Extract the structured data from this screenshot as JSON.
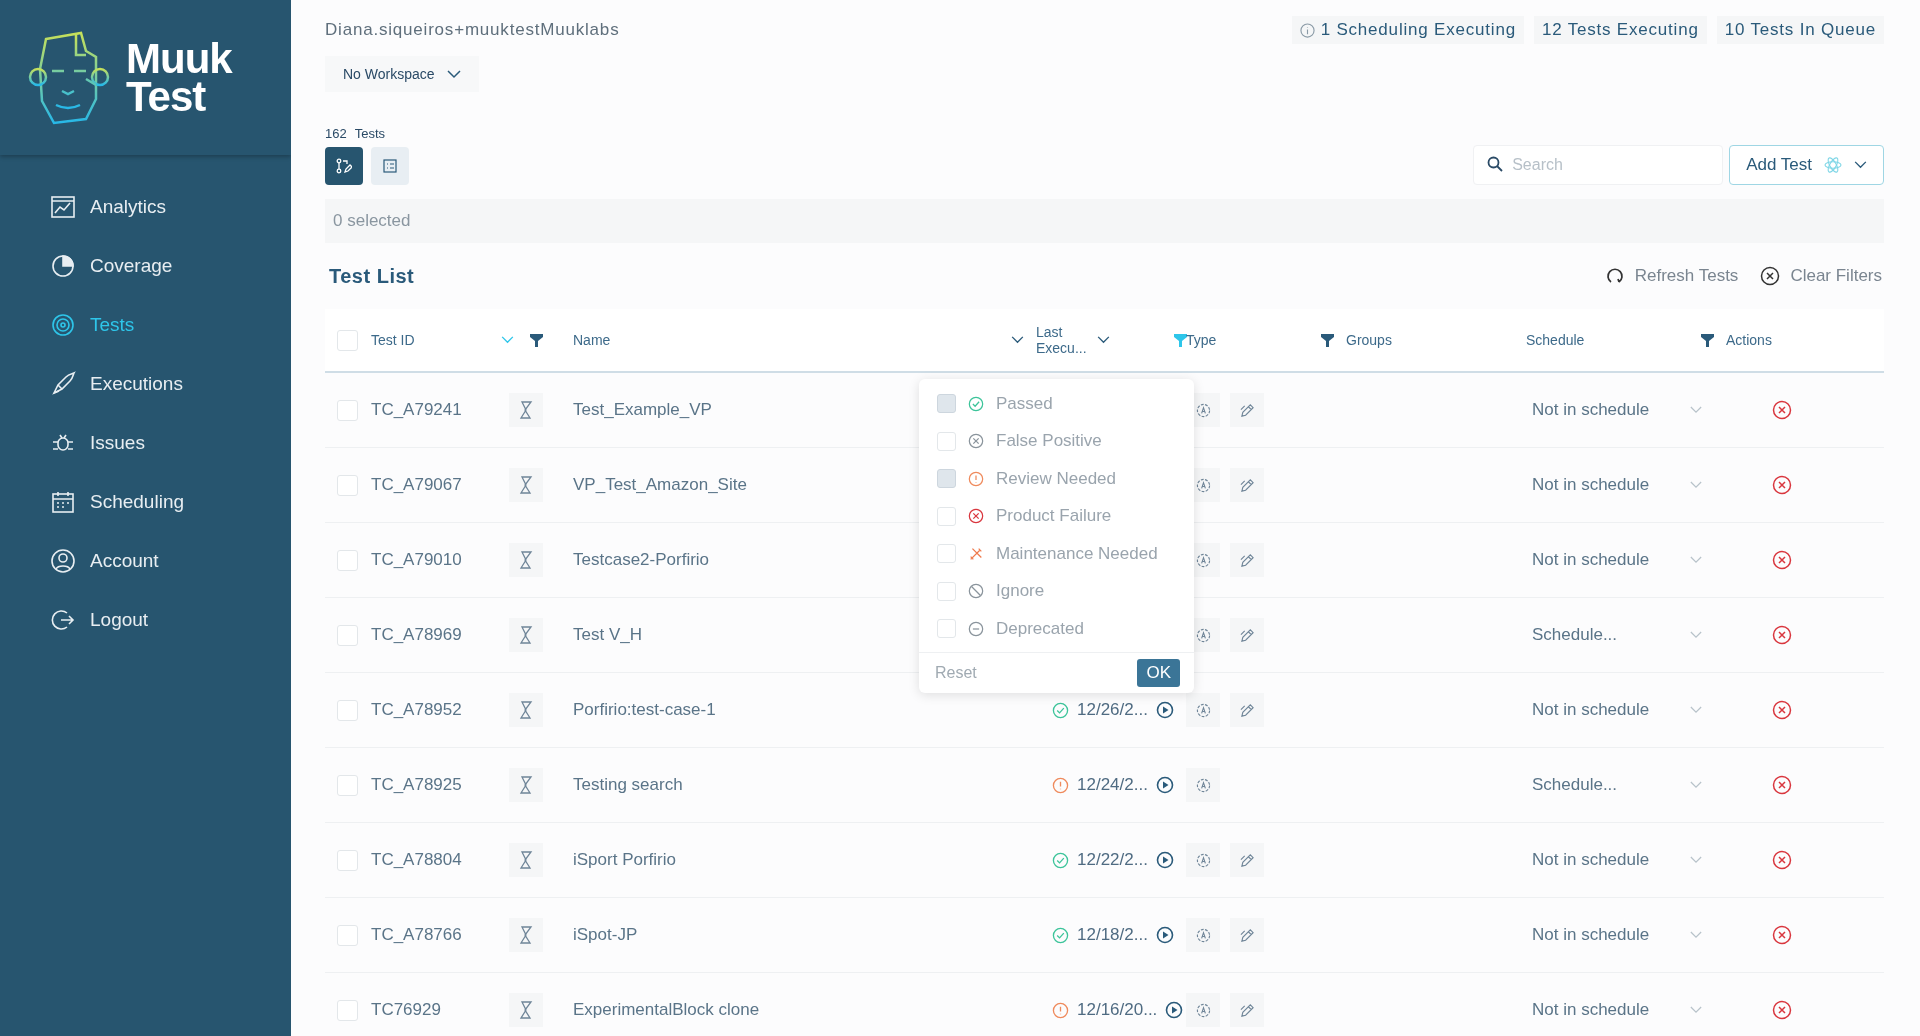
{
  "sidebar": {
    "logo": {
      "top": "Muuk",
      "bottom": "Test"
    },
    "items": [
      {
        "label": "Analytics",
        "kind": "analytics",
        "selected": false
      },
      {
        "label": "Coverage",
        "kind": "coverage",
        "selected": false
      },
      {
        "label": "Tests",
        "kind": "tests",
        "selected": true
      },
      {
        "label": "Executions",
        "kind": "executions",
        "selected": false
      },
      {
        "label": "Issues",
        "kind": "issues",
        "selected": false
      },
      {
        "label": "Scheduling",
        "kind": "scheduling",
        "selected": false
      },
      {
        "label": "Account",
        "kind": "account",
        "selected": false
      },
      {
        "label": "Logout",
        "kind": "logout",
        "selected": false
      }
    ]
  },
  "header": {
    "user": "Diana.siqueiros+muuktestMuuklabs",
    "workspace": "No Workspace",
    "counters": [
      {
        "text": "1 Scheduling Executing",
        "info": true
      },
      {
        "text": "12 Tests Executing",
        "info": false
      },
      {
        "text": "10 Tests In Queue",
        "info": false
      }
    ]
  },
  "tests_count": {
    "number": "162",
    "label": "Tests"
  },
  "view_toggle": [
    {
      "kind": "flow",
      "selected": true
    },
    {
      "kind": "list",
      "selected": false
    }
  ],
  "search": {
    "placeholder": "Search"
  },
  "add_button": "Add Test",
  "selection": "0 selected",
  "test_list": {
    "title": "Test List",
    "refresh": "Refresh Tests",
    "clear": "Clear Filters"
  },
  "table": {
    "columns": [
      {
        "label": "Test ID",
        "sort_active": true,
        "filter_active": false
      },
      {
        "label": "Name",
        "sort_active": false
      },
      {
        "label": "Last Execu...",
        "sort_active": false,
        "filter_active": true
      },
      {
        "label": "Type",
        "filter_active": false
      },
      {
        "label": "Groups"
      },
      {
        "label": "Schedule",
        "filter_active": false
      },
      {
        "label": "Actions"
      }
    ],
    "select_all_checked": false,
    "rows": [
      {
        "id": "TC_A79241",
        "checked": false,
        "name": "Test_Example_VP",
        "editable": true,
        "schedule": "Not in schedule"
      },
      {
        "id": "TC_A79067",
        "checked": false,
        "name": "VP_Test_Amazon_Site",
        "editable": true,
        "schedule": "Not in schedule"
      },
      {
        "id": "TC_A79010",
        "checked": false,
        "name": "Testcase2-Porfirio",
        "editable": true,
        "schedule": "Not in schedule"
      },
      {
        "id": "TC_A78969",
        "checked": false,
        "name": "Test V_H",
        "editable": true,
        "schedule": "Schedule..."
      },
      {
        "id": "TC_A78952",
        "checked": false,
        "name": "Porfirio:test-case-1",
        "kind": "passed",
        "last_execution": "12/26/2...",
        "editable": true,
        "schedule": "Not in schedule"
      },
      {
        "id": "TC_A78925",
        "checked": false,
        "name": "Testing search",
        "kind": "review",
        "last_execution": "12/24/2...",
        "editable": false,
        "schedule": "Schedule..."
      },
      {
        "id": "TC_A78804",
        "checked": false,
        "name": "iSport Porfirio",
        "kind": "passed",
        "last_execution": "12/22/2...",
        "editable": true,
        "schedule": "Not in schedule"
      },
      {
        "id": "TC_A78766",
        "checked": false,
        "name": "iSpot-JP",
        "kind": "passed",
        "last_execution": "12/18/2...",
        "editable": true,
        "schedule": "Not in schedule"
      },
      {
        "id": "TC76929",
        "checked": false,
        "name": "ExperimentalBlock clone",
        "kind": "review",
        "last_execution": "12/16/20...",
        "editable": true,
        "schedule": "Not in schedule"
      }
    ]
  },
  "filter_menu": {
    "options": [
      {
        "label": "Passed",
        "kind": "passed",
        "checked": true
      },
      {
        "label": "False Positive",
        "kind": "false_positive",
        "checked": false
      },
      {
        "label": "Review Needed",
        "kind": "review",
        "checked": true
      },
      {
        "label": "Product Failure",
        "kind": "failure",
        "checked": false
      },
      {
        "label": "Maintenance Needed",
        "kind": "maintenance",
        "checked": false
      },
      {
        "label": "Ignore",
        "kind": "ignore",
        "checked": false
      },
      {
        "label": "Deprecated",
        "kind": "deprecated",
        "checked": false
      }
    ],
    "reset": "Reset",
    "ok": "OK"
  }
}
